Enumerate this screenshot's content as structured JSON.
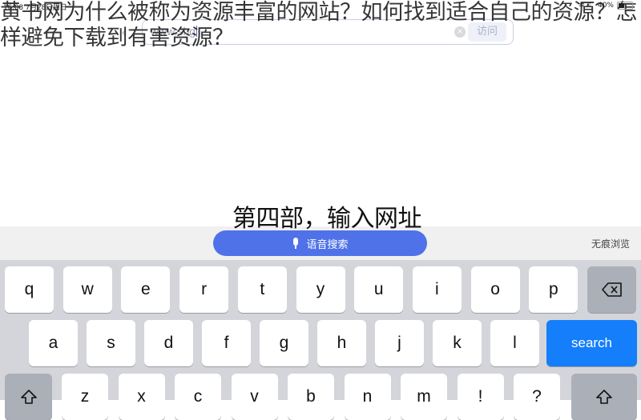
{
  "status_bar": {
    "time_date": "16:08  7月28日周日",
    "battery_percent": "40%",
    "icons": [
      "wifi-icon",
      "moon-icon",
      "battery-icon"
    ]
  },
  "headline": "黄书网为什么被称为资源丰富的网站？如何找到适合自己的资源？怎样避免下载到有害资源？",
  "browser": {
    "back_icon": "‹",
    "url_value": "www.shg",
    "clear_icon": "×",
    "visit_label": "访问"
  },
  "step_caption": "第四部，输入网址",
  "toolbar": {
    "voice_search_label": "语音搜索",
    "incognito_label": "无痕浏览"
  },
  "keyboard": {
    "row1": [
      "q",
      "w",
      "e",
      "r",
      "t",
      "y",
      "u",
      "i",
      "o",
      "p"
    ],
    "row2": [
      "a",
      "s",
      "d",
      "f",
      "g",
      "h",
      "j",
      "k",
      "l"
    ],
    "row3": [
      "z",
      "x",
      "c",
      "v",
      "b",
      "n",
      "m",
      "!",
      "?"
    ],
    "search_label": "search",
    "colors": {
      "search": "#147efb",
      "key": "#ffffff",
      "modifier": "#abafb8",
      "background": "#d3d5da"
    }
  }
}
